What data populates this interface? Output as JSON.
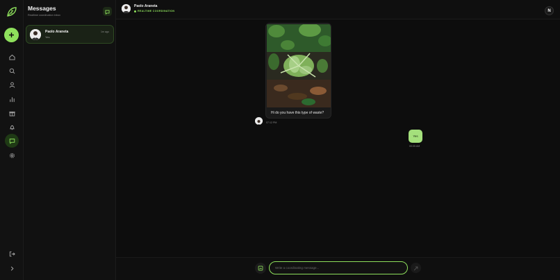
{
  "rail": {
    "icons": [
      "leaf-logo-icon",
      "plus-icon",
      "home-icon",
      "search-icon",
      "user-icon",
      "bar-chart-icon",
      "gift-icon",
      "bell-icon",
      "message-icon",
      "gear-icon",
      "logout-icon",
      "chevron-right-icon"
    ],
    "active": "message-icon"
  },
  "sidebar": {
    "title": "Messages",
    "subtitle": "Realtime coordination inbox",
    "new_chat_icon": "chat-bubble-icon"
  },
  "conversations": [
    {
      "name": "Paolo Araneta",
      "time": "1m ago",
      "preview": "Yes"
    }
  ],
  "chat": {
    "contact_name": "Paolo Araneta",
    "status": "REALTIME COORDINATION",
    "user_badge": "N"
  },
  "messages": {
    "incoming": {
      "text": "Hi do you have this type of waste?",
      "time": "07:12 PM"
    },
    "outgoing": {
      "text": "Yes",
      "time": "00:05 AM"
    }
  },
  "composer": {
    "placeholder": "Write a coordinating message...",
    "value": ""
  },
  "colors": {
    "accent": "#8ee05c",
    "background": "#0d0d0d",
    "outgoing_bubble": "#a4e07c"
  }
}
